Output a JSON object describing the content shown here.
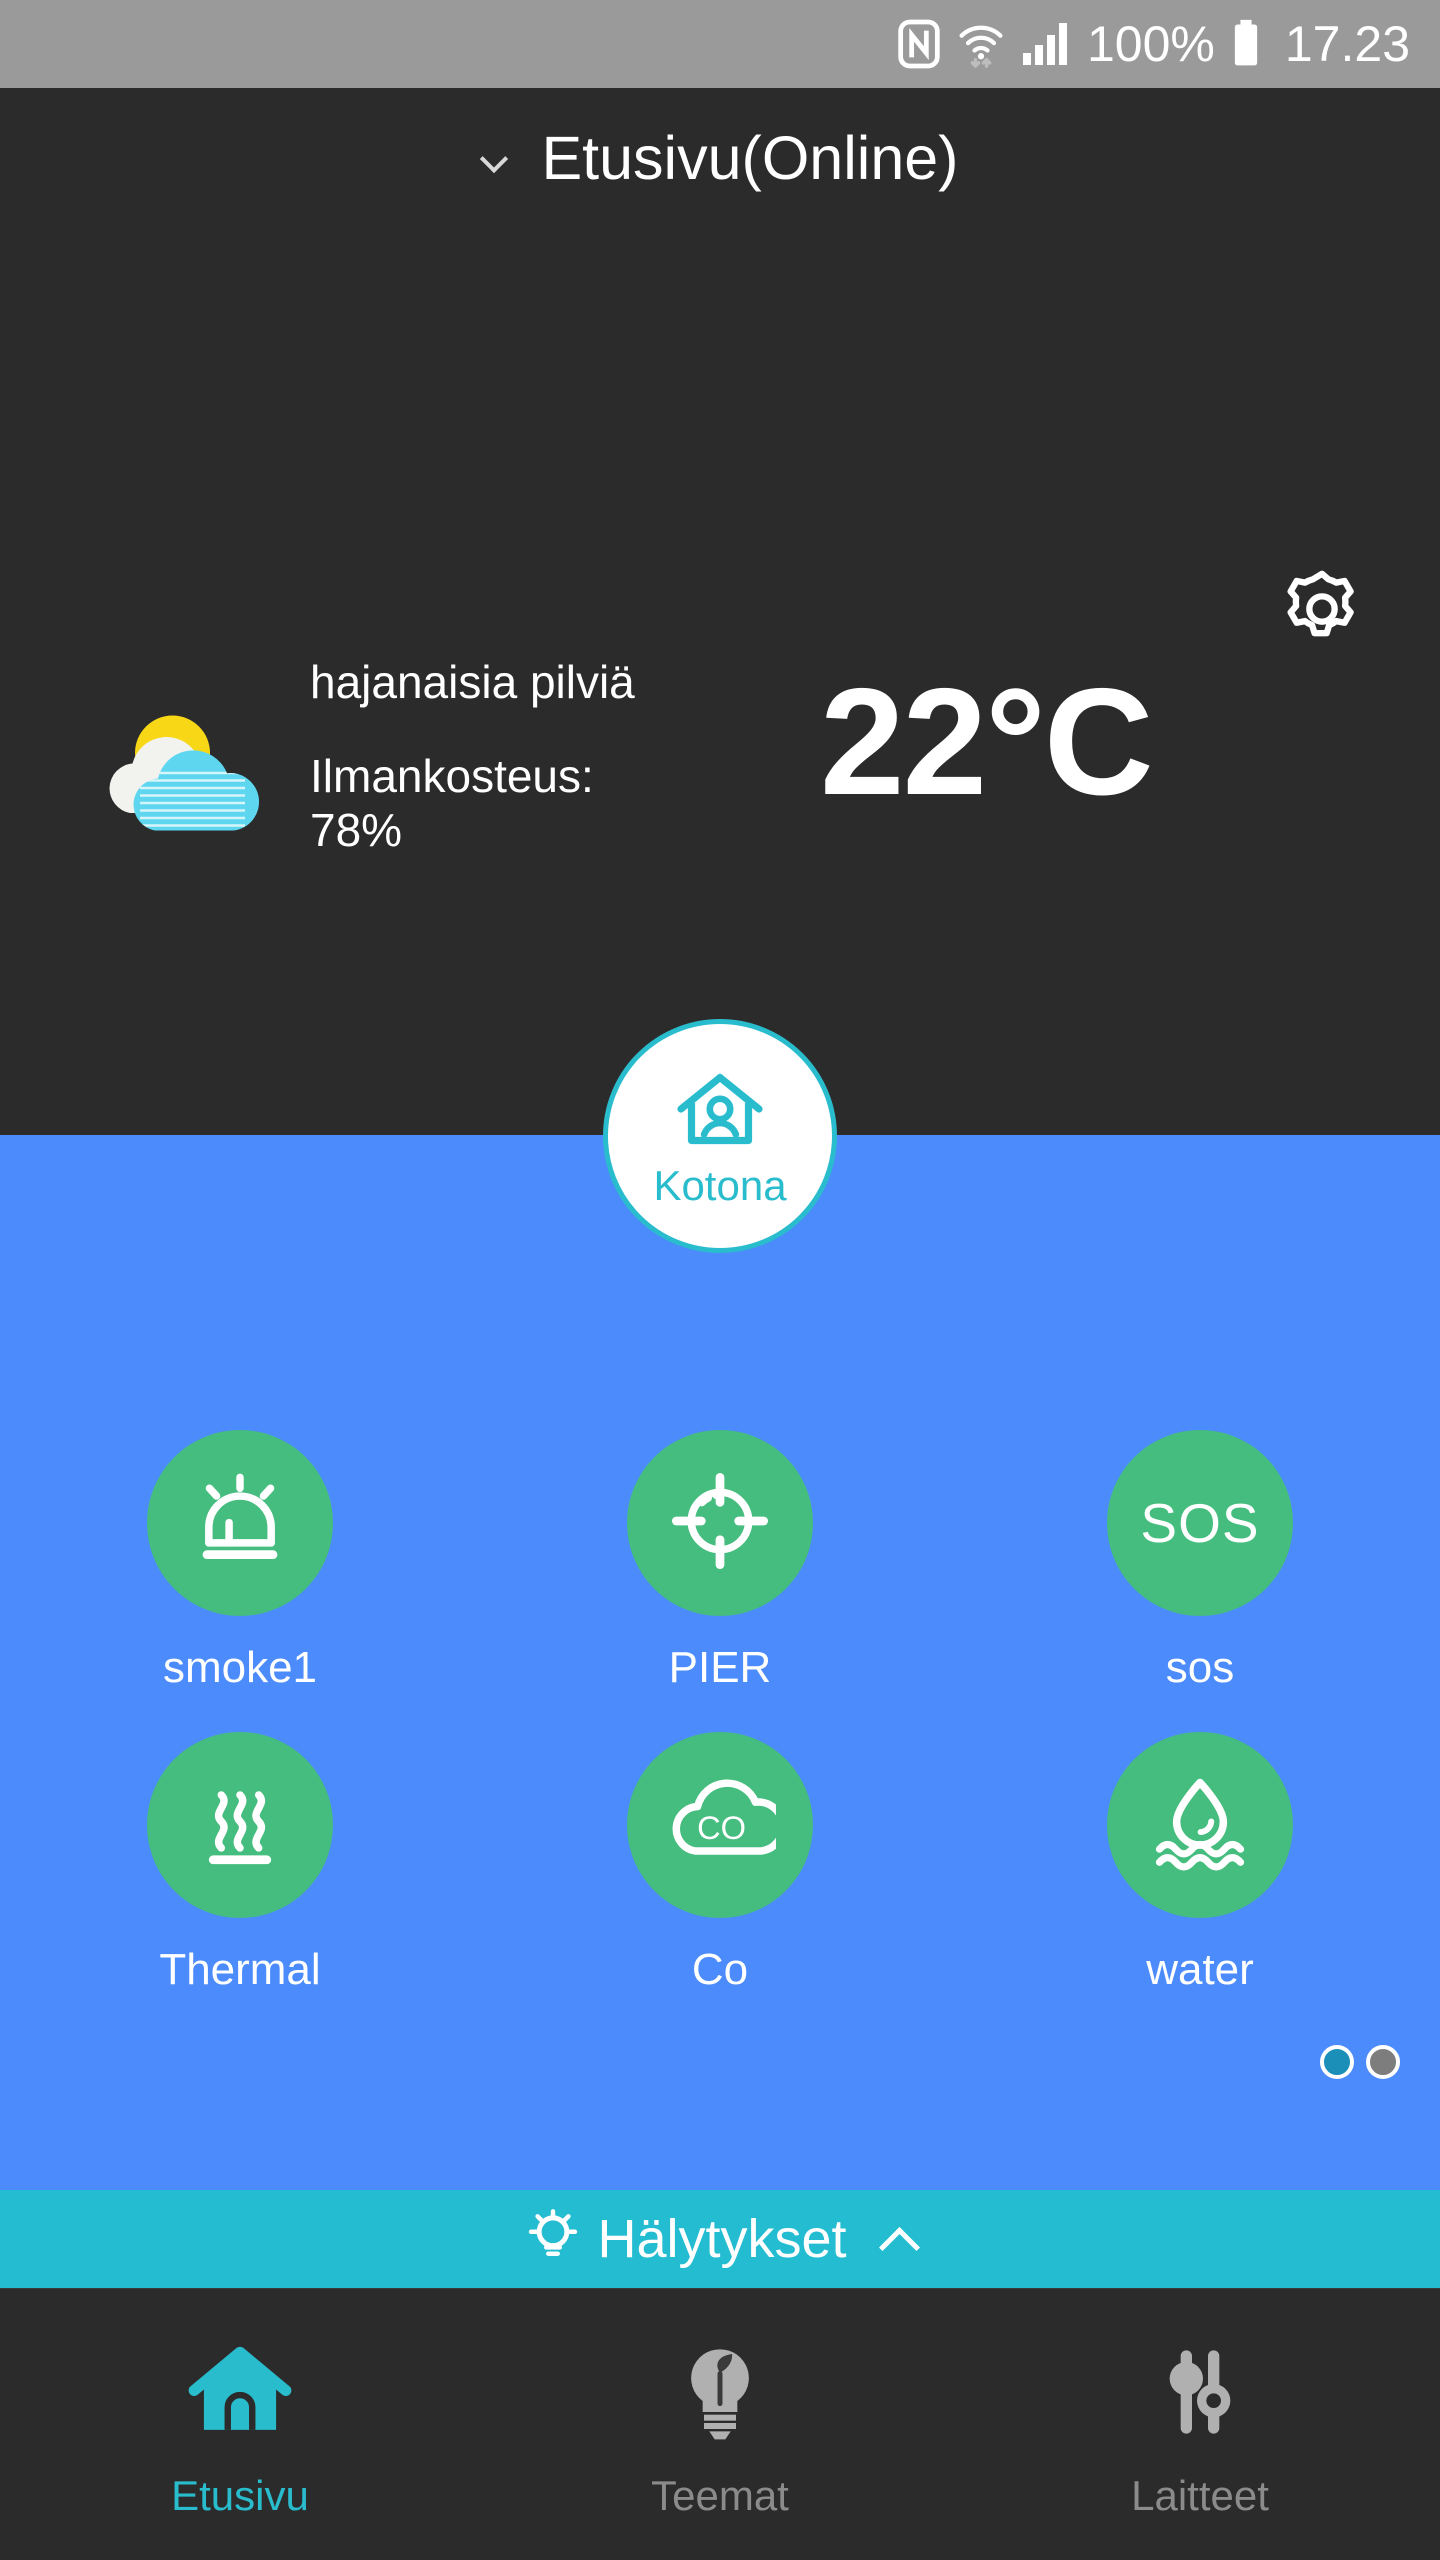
{
  "statusbar": {
    "nfc_icon": "nfc-icon",
    "wifi_icon": "wifi-icon",
    "signal_icon": "signal-bars-icon",
    "battery_percent": "100%",
    "battery_icon": "battery-full-icon",
    "time": "17.23"
  },
  "header": {
    "chevron_icon": "chevron-down-icon",
    "title": "Etusivu(Online)",
    "settings_icon": "gear-icon"
  },
  "weather": {
    "icon": "sun-behind-cloud-icon",
    "condition": "hajanaisia pilviä",
    "humidity": "Ilmankosteus:\n78%",
    "humidity_label": "Ilmankosteus:",
    "humidity_value": "78%",
    "temperature": "22°C"
  },
  "mode_button": {
    "icon": "home-person-icon",
    "label": "Kotona"
  },
  "devices": [
    {
      "label": "smoke1",
      "icon": "siren-alarm-icon",
      "status_color": "#45bd7f"
    },
    {
      "label": "PIER",
      "icon": "crosshair-target-icon",
      "status_color": "#45bd7f"
    },
    {
      "label": "sos",
      "icon": "sos-text-icon",
      "icon_text": "SOS",
      "status_color": "#45bd7f"
    },
    {
      "label": "Thermal",
      "icon": "heat-waves-icon",
      "status_color": "#45bd7f"
    },
    {
      "label": "Co",
      "icon": "cloud-co-icon",
      "icon_text": "CO",
      "status_color": "#45bd7f"
    },
    {
      "label": "water",
      "icon": "water-drop-waves-icon",
      "status_color": "#45bd7f"
    }
  ],
  "pagination": {
    "total": 2,
    "active_index": 0
  },
  "alarm_bar": {
    "icon": "lightbulb-icon",
    "label": "Hälytykset",
    "chevron_icon": "chevron-up-icon"
  },
  "bottom_nav": [
    {
      "label": "Etusivu",
      "icon": "home-icon",
      "active": true
    },
    {
      "label": "Teemat",
      "icon": "bulb-leaf-icon",
      "active": false
    },
    {
      "label": "Laitteet",
      "icon": "sliders-icon",
      "active": false
    }
  ],
  "colors": {
    "status_bar_bg": "#9a9a9a",
    "dark_bg": "#2b2b2b",
    "blue_bg": "#4b8bfb",
    "green_device": "#45bd7f",
    "teal_accent": "#29bccd",
    "alarm_bar_bg": "#23bcd1",
    "inactive_gray": "#8b8b8b"
  }
}
